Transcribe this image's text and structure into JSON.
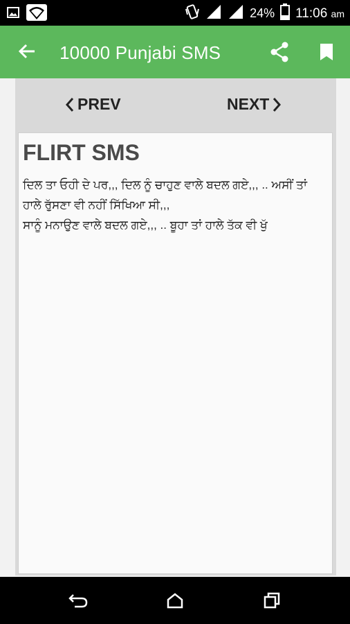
{
  "status": {
    "battery_pct": "24%",
    "time": "11:06",
    "ampm": "am"
  },
  "app_bar": {
    "title": "10000 Punjabi SMS"
  },
  "nav": {
    "prev_label": "PREV",
    "next_label": "NEXT"
  },
  "sms": {
    "title": "FLIRT SMS",
    "body": "ਦਿਲ ਤਾ ਓਹੀ ਦੇ ਪਰ,,, ਦਿਲ ਨੂੰ ਚਾਹੁਣ ਵਾਲੇ ਬਦਲ ਗਏ,,, .. ਅਸੀਂ ਤਾਂ ਹਾਲੇ ਰੁੱਸਣਾ ਵੀ ਨਹੀਂ ਸਿੱਖਿਆ ਸੀ,,,\nਸਾਨੂੰ ਮਨਾਉਣ ਵਾਲੇ ਬਦਲ ਗਏ,,, .. ਬੂਹਾ ਤਾਂ ਹਾਲੇ ਤੱਕ ਵੀ ਖੁੱ"
  },
  "icons": {
    "image": "image-icon",
    "wifi": "wifi-icon",
    "vibrate": "vibrate-icon",
    "signal1": "signal-icon",
    "signal2": "signal-icon",
    "battery": "battery-icon",
    "back": "arrow-back-icon",
    "share": "share-icon",
    "bookmark": "bookmark-icon",
    "sys_back": "system-back-icon",
    "home": "home-icon",
    "recents": "recents-icon"
  },
  "colors": {
    "app_bar": "#5cb85c",
    "nav_panel": "#d9d9d9"
  }
}
